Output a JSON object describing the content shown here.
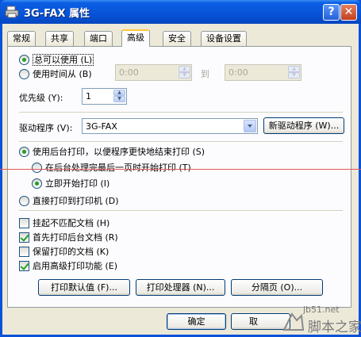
{
  "window": {
    "title": "3G-FAX 属性",
    "help_label": "?",
    "close_label": "✕"
  },
  "tabs": [
    {
      "label": "常规"
    },
    {
      "label": "共享"
    },
    {
      "label": "端口"
    },
    {
      "label": "高级"
    },
    {
      "label": "安全"
    },
    {
      "label": "设备设置"
    }
  ],
  "availability": {
    "always_label": "总可以使用 (L)",
    "from_label": "使用时间从 (B)",
    "from_time": "0:00",
    "to_label": "到",
    "to_time": "0:00"
  },
  "priority": {
    "label": "优先级 (Y):",
    "value": "1"
  },
  "driver": {
    "label": "驱动程序 (V):",
    "value": "3G-FAX",
    "new_driver_label": "新驱动程序 (W)..."
  },
  "spool": {
    "use_spool_label": "使用后台打印，以便程序更快地结束打印 (S)",
    "after_last_page_label": "在后台处理完最后一页时开始打印 (T)",
    "immediately_label": "立即开始打印 (I)",
    "direct_label": "直接打印到打印机 (D)"
  },
  "options": {
    "hold_mismatched_label": "挂起不匹配文档 (H)",
    "print_spooled_first_label": "首先打印后台文档 (R)",
    "keep_printed_label": "保留打印的文档 (K)",
    "advanced_features_label": "启用高级打印功能 (E)"
  },
  "buttons": {
    "defaults_label": "打印默认值 (F)...",
    "processor_label": "打印处理器 (N)...",
    "separator_label": "分隔页 (O)...",
    "ok_label": "确定",
    "cancel_label": "取"
  },
  "watermark": {
    "site": "jb51.net",
    "brand": "脚本之家"
  },
  "colors": {
    "titlebar": "#0753d8",
    "dialog_bg": "#ece9d8",
    "check_green": "#21a121",
    "annotation_line": "#e25555"
  }
}
